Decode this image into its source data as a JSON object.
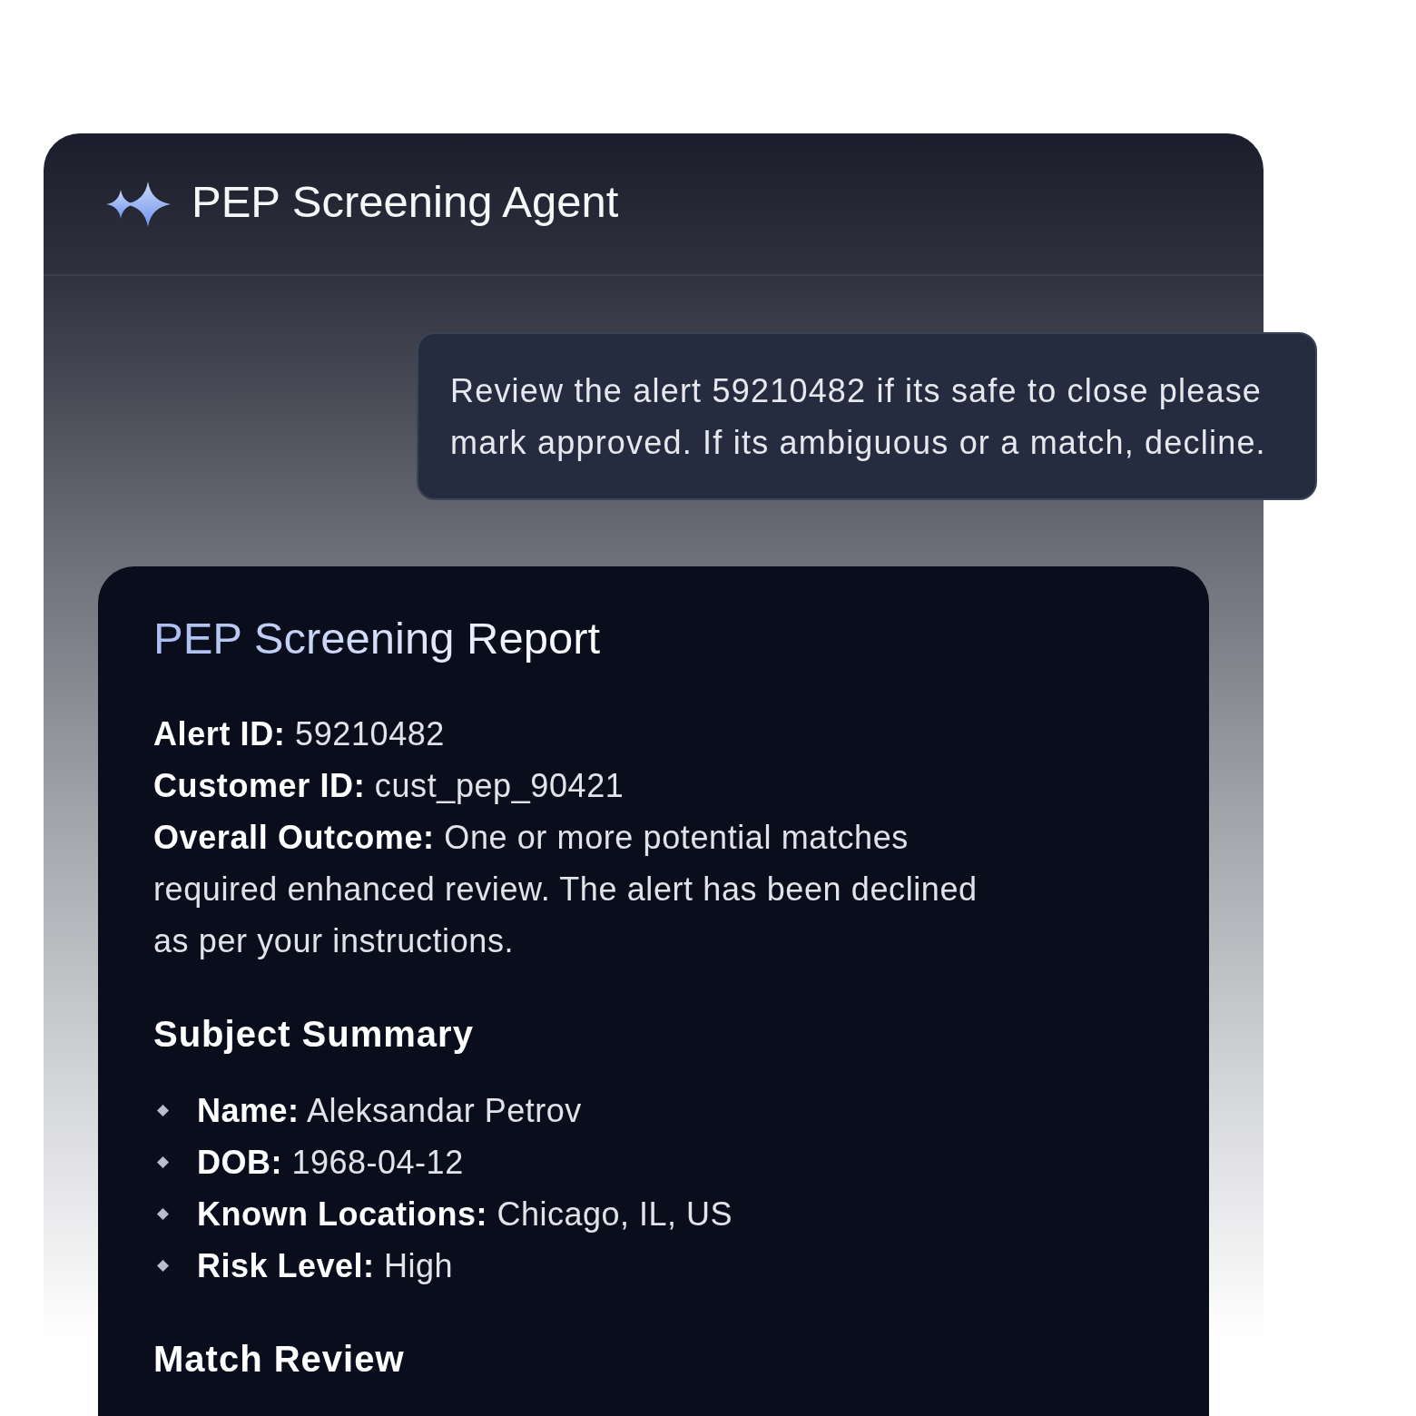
{
  "agent": {
    "title": "PEP Screening Agent"
  },
  "user_message": {
    "text": "Review the alert 59210482 if its safe to close please mark approved. If its ambiguous or a match, decline."
  },
  "report": {
    "title": "PEP Screening Report",
    "fields": [
      "**Alert ID:** 59210482",
      "**Customer ID:** cust_pep_90421",
      "**Overall Outcome:** One or more potential matches required enhanced review. The alert has been declined as per your instructions."
    ],
    "sections": [
      {
        "heading": "Subject Summary",
        "items": [
          "**Name:** Aleksandar Petrov",
          "**DOB:** 1968-04-12",
          "**Known Locations:** Chicago, IL, US",
          "**Risk Level:** High"
        ]
      },
      {
        "heading": "Match Review"
      }
    ]
  }
}
